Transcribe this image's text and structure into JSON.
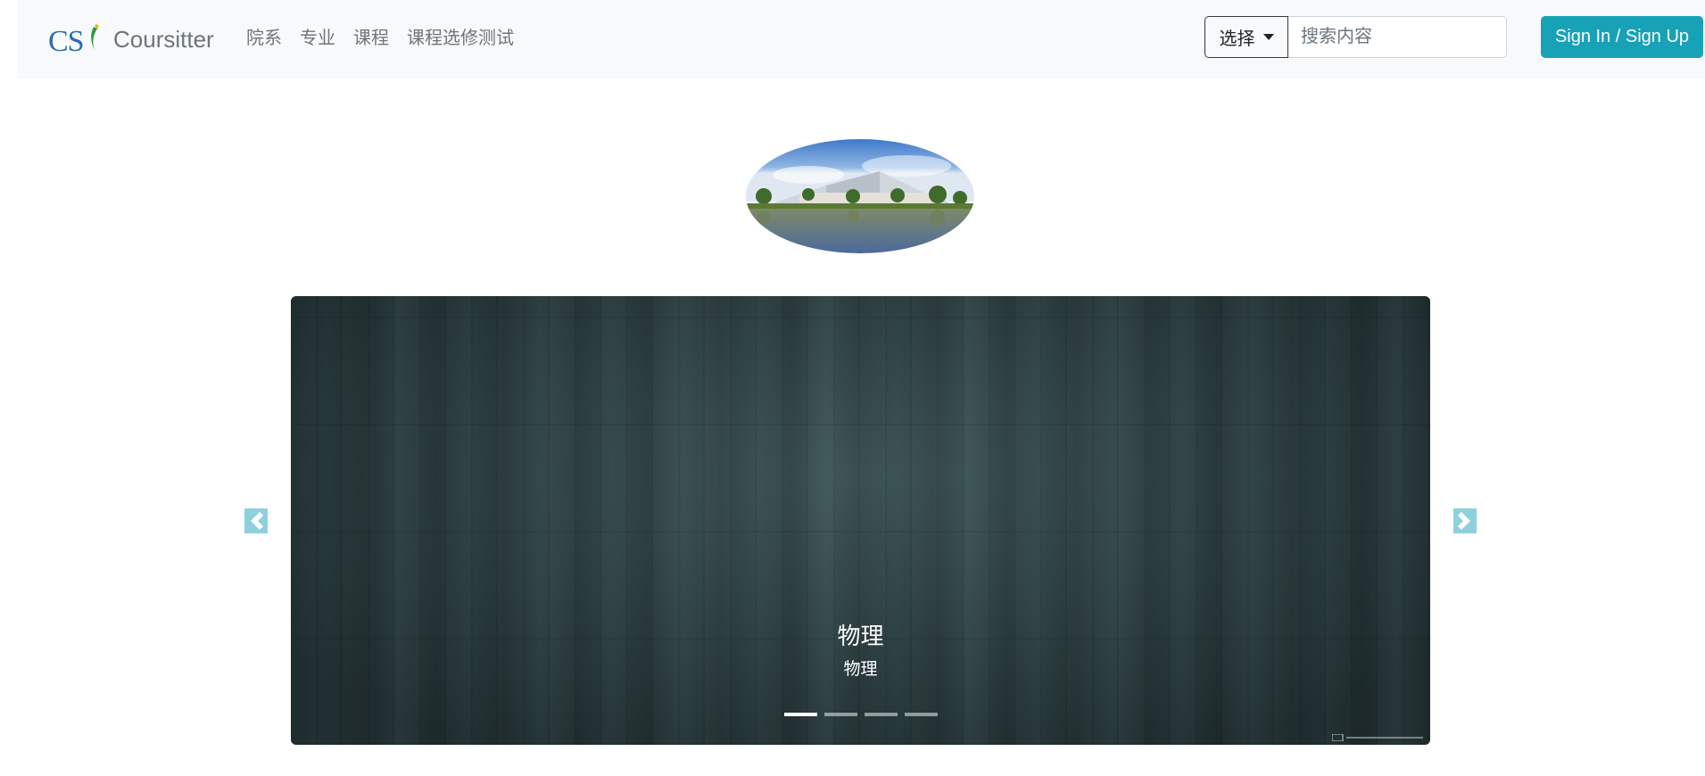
{
  "brand": {
    "logo_text": "CS",
    "name": "Coursitter"
  },
  "nav": {
    "links": [
      {
        "label": "院系"
      },
      {
        "label": "专业"
      },
      {
        "label": "课程"
      },
      {
        "label": "课程选修测试"
      }
    ]
  },
  "search": {
    "select_label": "选择",
    "placeholder": "搜索内容",
    "value": ""
  },
  "auth": {
    "signin_label": "Sign In / Sign Up"
  },
  "carousel": {
    "slide_title": "物理",
    "slide_subtitle": "物理",
    "active_index": 0,
    "slide_count": 4
  },
  "colors": {
    "accent": "#17a2b8",
    "navbar_bg": "#f8f9fa",
    "arrow": "#8fd0dd"
  }
}
